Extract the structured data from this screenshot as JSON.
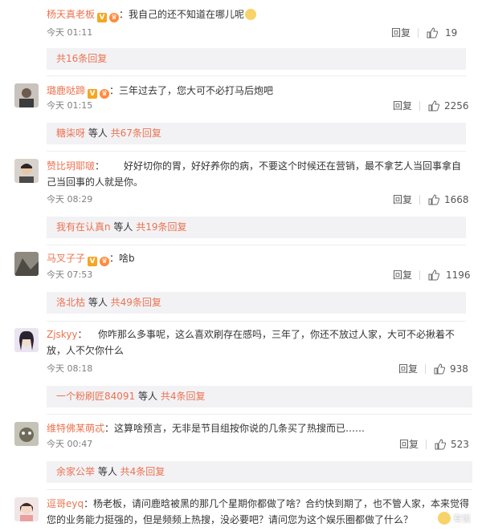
{
  "comments": [
    {
      "user": "杨天真老板",
      "text": "我自己的还不知道在哪儿呢",
      "time": "今天 01:11",
      "reply": "回复",
      "likes": "19",
      "thread": {
        "prefix": "",
        "mid": "",
        "link": "共16条回复"
      }
    },
    {
      "user": "璐鹿哒蹄",
      "text": "三年过去了，您大可不必打马后炮吧",
      "time": "今天 01:15",
      "reply": "回复",
      "likes": "2256",
      "thread": {
        "prefix": "糖柒呀",
        "mid": " 等人 ",
        "link": "共67条回复"
      }
    },
    {
      "user": "赞比玥耶啵",
      "text": "好好切你的胃，好好养你的病，不要这个时候还在营销，最不拿艺人当回事拿自己当回事的人就是你。",
      "time": "今天 08:29",
      "reply": "回复",
      "likes": "1668",
      "thread": {
        "prefix": "我有在认真n",
        "mid": " 等人 ",
        "link": "共19条回复"
      }
    },
    {
      "user": "马叉子子",
      "text": "啥b",
      "time": "今天 07:53",
      "reply": "回复",
      "likes": "1196",
      "thread": {
        "prefix": "洛北枯",
        "mid": " 等人 ",
        "link": "共49条回复"
      }
    },
    {
      "user": "Zjskyy",
      "text": "你咋那么多事呢，这么喜欢刷存在感吗，三年了，你还不放过人家，大可不必揪着不放，人不欠你什么",
      "time": "今天 08:18",
      "reply": "回复",
      "likes": "938",
      "thread": {
        "prefix": "一个粉刷匠84091",
        "mid": " 等人 ",
        "link": "共4条回复"
      }
    },
    {
      "user": "维特佛某萌忒",
      "text": "这算啥预言，无非是节目组按你说的几条买了热搜而已……",
      "time": "今天 00:47",
      "reply": "回复",
      "likes": "523",
      "thread": {
        "prefix": "余家公举",
        "mid": " 等人 ",
        "link": "共4条回复"
      }
    },
    {
      "user": "逗哥eyq",
      "text": "杨老板，请问鹿晗被黑的那几个星期你都做了啥？合约快到期了，也不管人家，本来觉得您的业务能力挺强的，但是频频上热搜，没必要吧？请问您为这个娱乐圈都做了什么？"
    }
  ],
  "watermark": "有饭"
}
